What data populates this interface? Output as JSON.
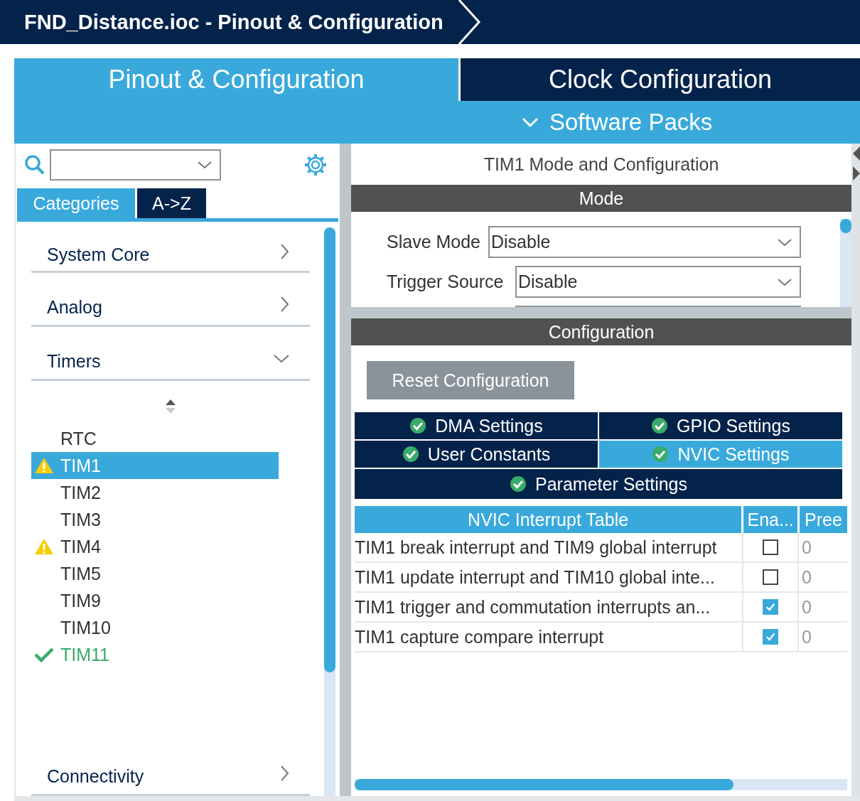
{
  "window": {
    "title": "FND_Distance.ioc - Pinout & Configuration"
  },
  "main_tabs": [
    {
      "label": "Pinout & Configuration",
      "selected": true
    },
    {
      "label": "Clock Configuration",
      "selected": false
    }
  ],
  "software_packs": {
    "label": "Software Packs"
  },
  "sidebar": {
    "view_tabs": [
      {
        "label": "Categories",
        "selected": true
      },
      {
        "label": "A->Z",
        "selected": false
      }
    ],
    "categories": [
      {
        "label": "System Core",
        "expanded": false
      },
      {
        "label": "Analog",
        "expanded": false
      },
      {
        "label": "Timers",
        "expanded": true,
        "children": [
          {
            "label": "RTC",
            "kind": "plain",
            "selected": false
          },
          {
            "label": "TIM1",
            "kind": "warning",
            "selected": true
          },
          {
            "label": "TIM2",
            "kind": "plain",
            "selected": false
          },
          {
            "label": "TIM3",
            "kind": "plain",
            "selected": false
          },
          {
            "label": "TIM4",
            "kind": "warning",
            "selected": false
          },
          {
            "label": "TIM5",
            "kind": "plain",
            "selected": false
          },
          {
            "label": "TIM9",
            "kind": "plain",
            "selected": false
          },
          {
            "label": "TIM10",
            "kind": "plain",
            "selected": false
          },
          {
            "label": "TIM11",
            "kind": "ok",
            "selected": false
          }
        ]
      },
      {
        "label": "Connectivity",
        "expanded": false
      }
    ]
  },
  "panel": {
    "title": "TIM1 Mode and Configuration",
    "mode": {
      "header": "Mode",
      "fields": [
        {
          "label": "Slave Mode",
          "value": "Disable"
        },
        {
          "label": "Trigger Source",
          "value": "Disable"
        }
      ]
    },
    "configuration": {
      "header": "Configuration",
      "reset_button": "Reset Configuration",
      "settings_tabs": [
        {
          "label": "DMA Settings",
          "selected": false
        },
        {
          "label": "GPIO Settings",
          "selected": false
        },
        {
          "label": "User Constants",
          "selected": false
        },
        {
          "label": "NVIC Settings",
          "selected": true
        },
        {
          "label": "Parameter Settings",
          "selected": false
        }
      ],
      "table": {
        "columns": [
          "NVIC Interrupt Table",
          "Ena...",
          "Pree"
        ],
        "rows": [
          {
            "name": "TIM1 break interrupt and TIM9 global interrupt",
            "enabled": false,
            "column_3": "0"
          },
          {
            "name": "TIM1 update interrupt and TIM10 global inte...",
            "enabled": false,
            "column_3": "0"
          },
          {
            "name": "TIM1 trigger and commutation interrupts an...",
            "enabled": true,
            "column_3": "0"
          },
          {
            "name": "TIM1 capture compare interrupt",
            "enabled": true,
            "column_3": "0"
          }
        ]
      }
    }
  }
}
